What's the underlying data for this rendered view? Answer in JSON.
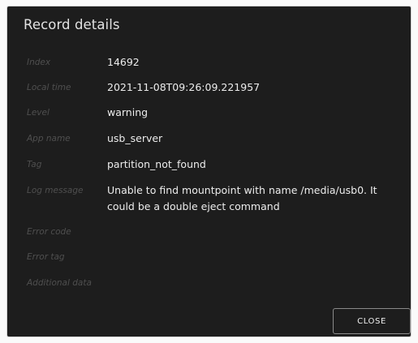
{
  "dialog": {
    "title": "Record details",
    "fields": [
      {
        "label": "Index",
        "value": "14692"
      },
      {
        "label": "Local time",
        "value": "2021-11-08T09:26:09.221957"
      },
      {
        "label": "Level",
        "value": "warning"
      },
      {
        "label": "App name",
        "value": "usb_server"
      },
      {
        "label": "Tag",
        "value": "partition_not_found"
      },
      {
        "label": "Log message",
        "value": "Unable to find mountpoint with name /media/usb0. It could be a double eject command"
      },
      {
        "label": "Error code",
        "value": ""
      },
      {
        "label": "Error tag",
        "value": ""
      },
      {
        "label": "Additional data",
        "value": ""
      }
    ],
    "close_label": "CLOSE"
  },
  "colors": {
    "dialog_background": "#1d1d1d",
    "label_text": "#4f4f4f",
    "value_text": "#ececec",
    "button_border": "#8a8a8a"
  }
}
